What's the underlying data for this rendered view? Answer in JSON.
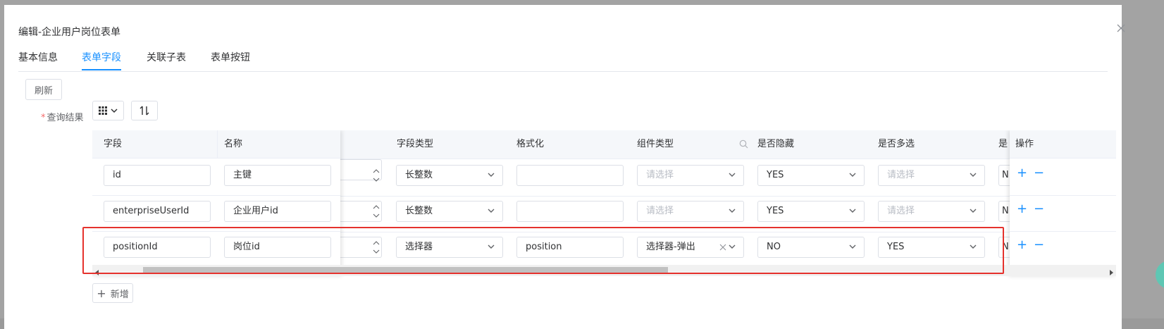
{
  "dialog": {
    "title": "编辑-企业用户岗位表单",
    "close_icon": "close-icon"
  },
  "tabs": [
    {
      "label": "基本信息",
      "active": false
    },
    {
      "label": "表单字段",
      "active": true
    },
    {
      "label": "关联子表",
      "active": false
    },
    {
      "label": "表单按钮",
      "active": false
    }
  ],
  "toolbar": {
    "refresh_label": "刷新",
    "query_label": "查询结果",
    "grid_icon": "grid-icon",
    "sort_icon": "sort-icon"
  },
  "table": {
    "headers": {
      "field": "字段",
      "name": "名称",
      "field_type": "字段类型",
      "format": "格式化",
      "component_type": "组件类型",
      "hidden": "是否隐藏",
      "multi": "是否多选",
      "partial": "是",
      "ops": "操作"
    },
    "placeholder": "请选择",
    "rows": [
      {
        "field": "id",
        "name": "主键",
        "field_type": "长整数",
        "format": "",
        "component_type": "",
        "hidden": "YES",
        "multi": "",
        "partial": "N"
      },
      {
        "field": "enterpriseUserId",
        "name": "企业用户id",
        "field_type": "长整数",
        "format": "",
        "component_type": "",
        "hidden": "YES",
        "multi": "",
        "partial": "N"
      },
      {
        "field": "positionId",
        "name": "岗位id",
        "field_type": "选择器",
        "format": "position",
        "component_type": "选择器-弹出",
        "hidden": "NO",
        "multi": "YES",
        "partial": "N"
      }
    ],
    "plus": "+",
    "minus": "−"
  },
  "add_button": {
    "label": "新增",
    "icon": "+"
  },
  "colors": {
    "accent": "#1890ff",
    "highlight": "#e5322d",
    "required": "#f56c6c"
  }
}
